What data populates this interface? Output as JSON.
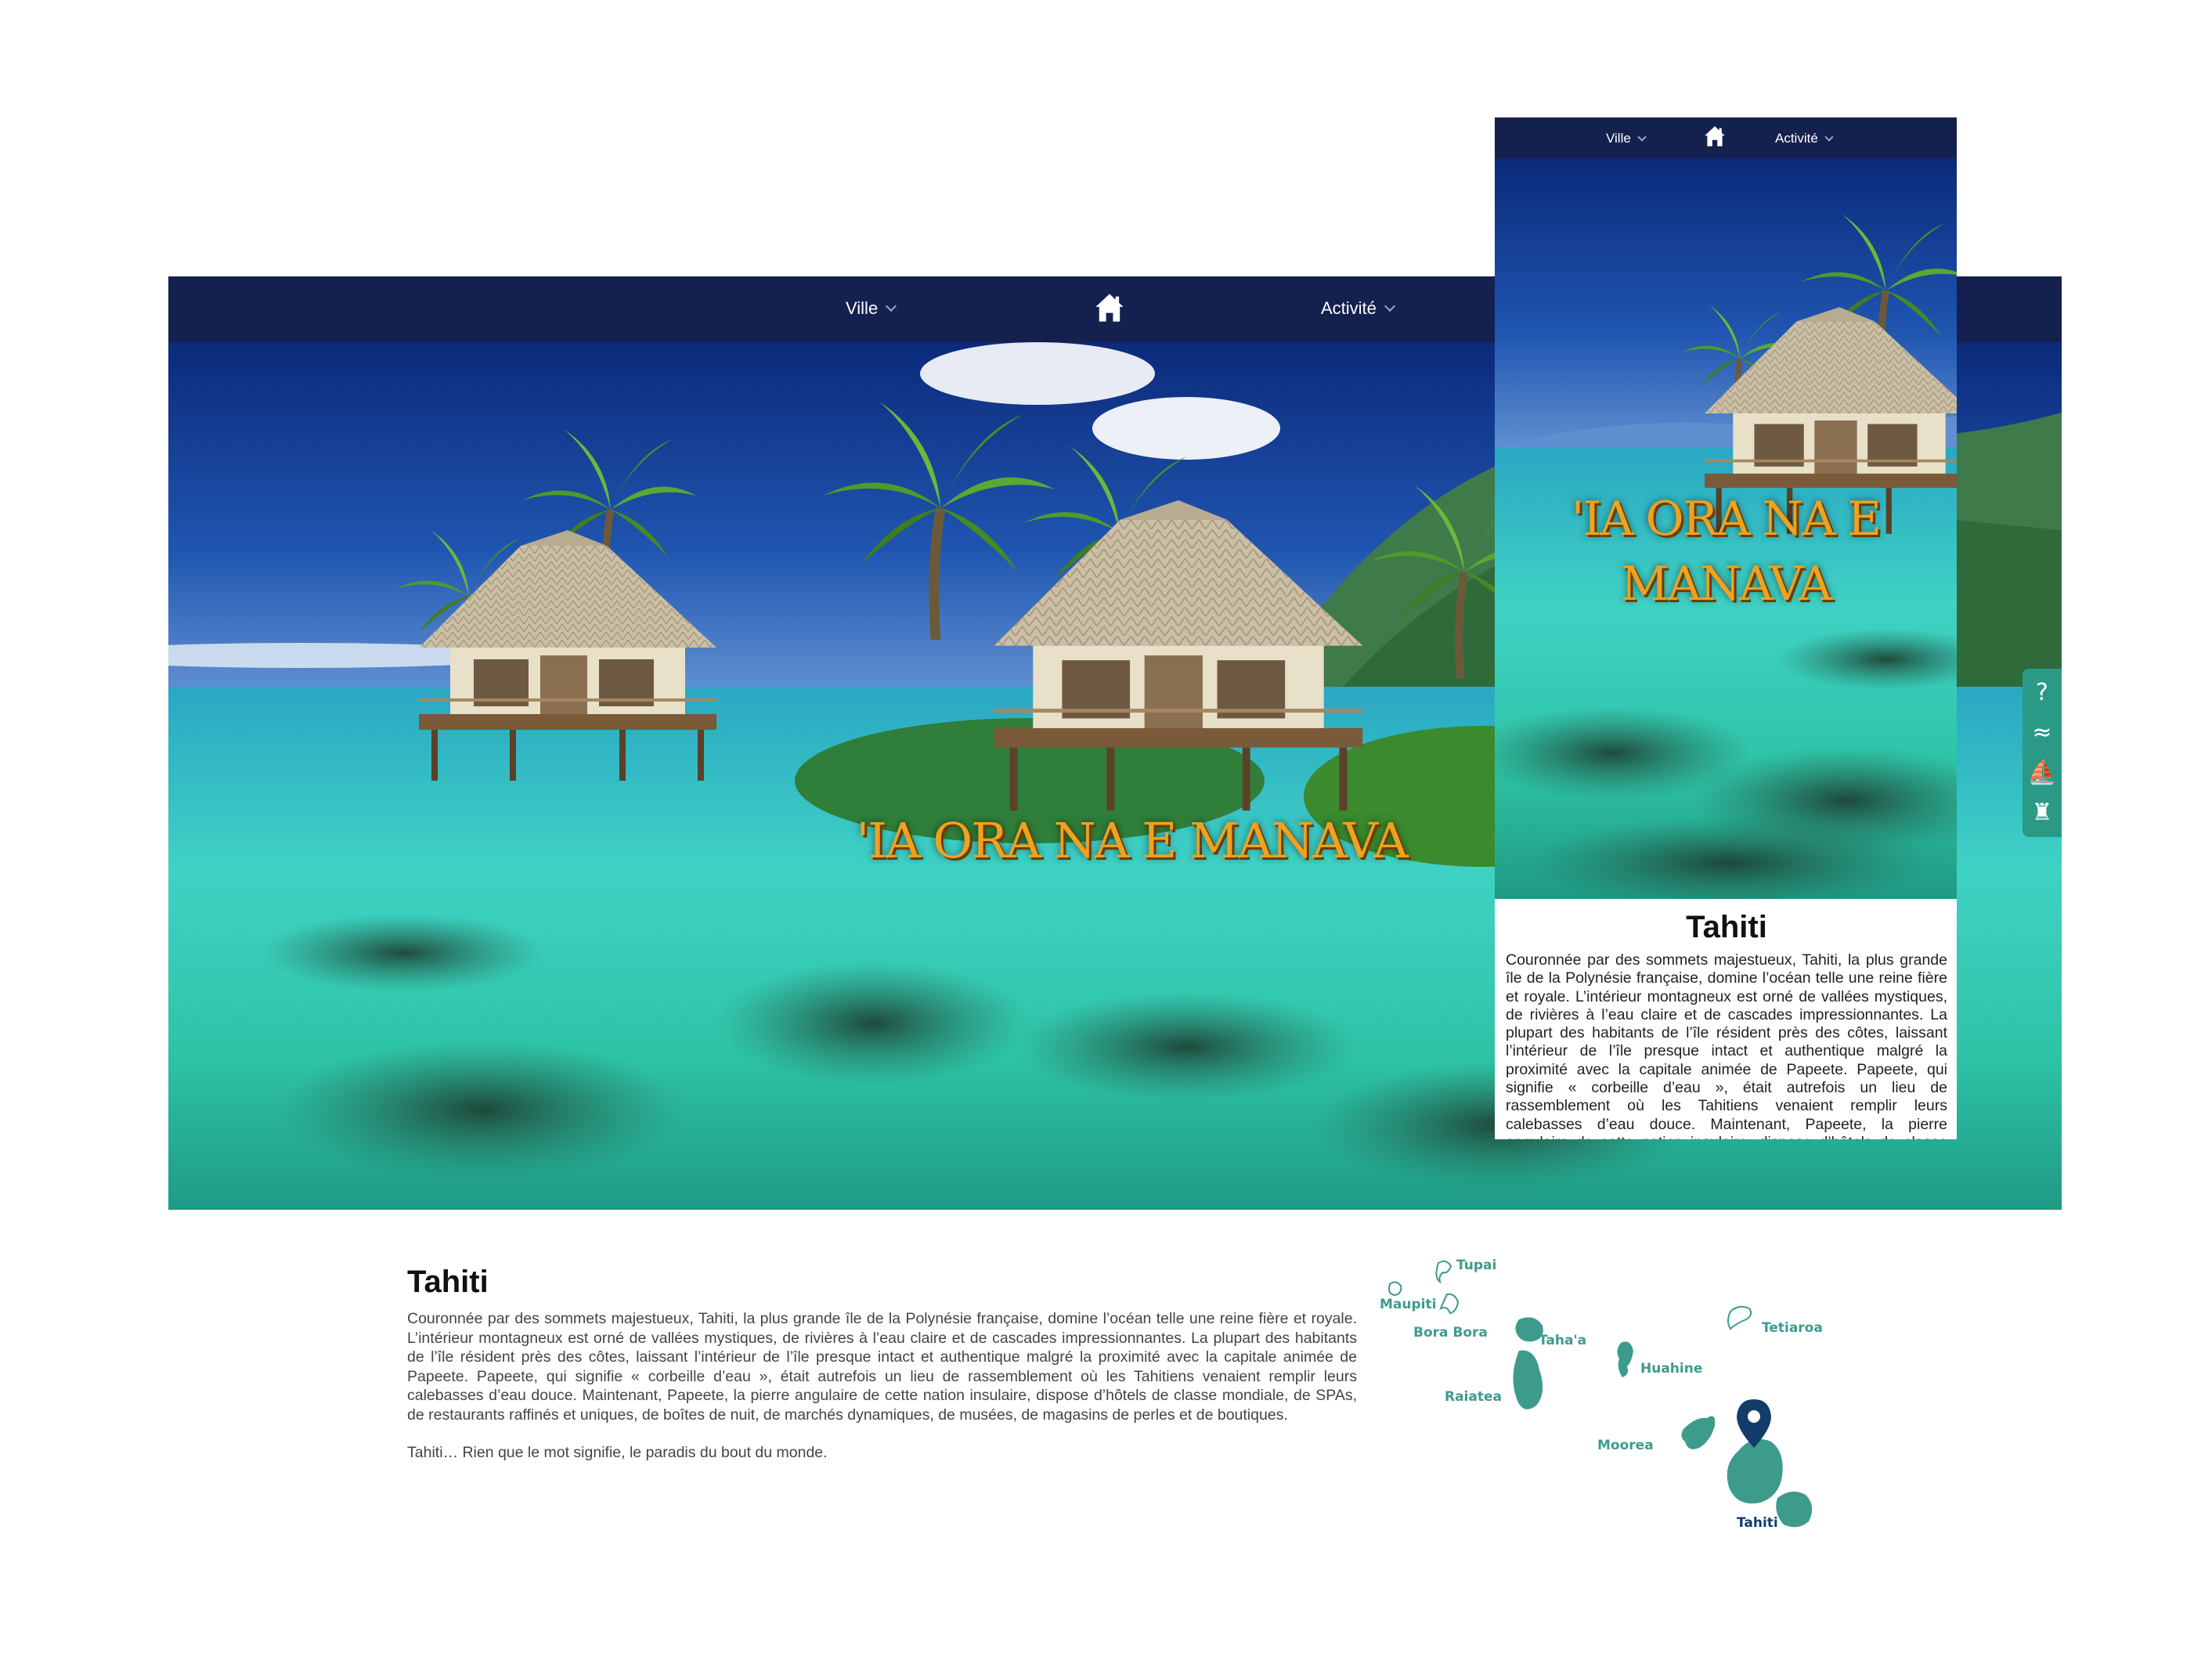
{
  "nav": {
    "ville_label": "Ville",
    "activite_label": "Activité",
    "home_icon": "home-icon"
  },
  "hero": {
    "title": "'IA ORA NA E MANAVA"
  },
  "side_tools": [
    "?",
    "≈",
    "⛵",
    "♜"
  ],
  "content": {
    "title": "Tahiti",
    "paragraph_1": "Couronnée par des sommets majestueux, Tahiti, la plus grande île de la Polynésie française, domine l’océan telle une reine fière et royale. L’intérieur montagneux est orné de vallées mystiques, de rivières à l’eau claire et de cascades impressionnantes. La plupart des habitants de l’île résident près des côtes, laissant l’intérieur de l’île presque intact et authentique malgré la proximité avec la capitale animée de Papeete. Papeete, qui signifie « corbeille d’eau », était autrefois un lieu de rassemblement où les Tahitiens venaient remplir leurs calebasses d’eau douce. Maintenant, Papeete, la pierre angulaire de cette nation insulaire, dispose d’hôtels de classe mondiale, de SPAs, de restaurants raffinés et uniques, de boîtes de nuit, de marchés dynamiques, de musées, de magasins de perles et de boutiques.",
    "paragraph_2": "Tahiti… Rien que le mot signifie, le paradis du bout du monde."
  },
  "map": {
    "islands": [
      "Tupai",
      "Maupiti",
      "Bora Bora",
      "Taha'a",
      "Tetiaroa",
      "Huahine",
      "Raiatea",
      "Moorea",
      "Tahiti"
    ],
    "selected": "Tahiti"
  },
  "colors": {
    "nav_bg": "#14214f",
    "title_gold": "#f0a21e",
    "island_teal": "#3d9b8c",
    "pin_blue": "#123d6b"
  }
}
